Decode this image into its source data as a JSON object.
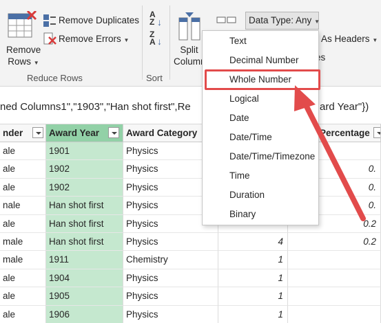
{
  "ribbon": {
    "remove_duplicates": "Remove Duplicates",
    "remove_errors": "Remove Errors",
    "remove_rows_line1": "Remove",
    "remove_rows_line2": "Rows",
    "reduce_rows_group": "Reduce Rows",
    "sort_group": "Sort",
    "split_line1": "Split",
    "split_line2": "Column",
    "data_type_button": "Data Type: Any",
    "as_headers": "As Headers",
    "partial_es": "es"
  },
  "formula_bar": {
    "text_left": "ned Columns1\",\"1903\",\"Han shot first\",Re",
    "text_right": "ard Year\"})"
  },
  "data_type_menu": {
    "items": [
      "Text",
      "Decimal Number",
      "Whole Number",
      "Logical",
      "Date",
      "Date/Time",
      "Date/Time/Timezone",
      "Time",
      "Duration",
      "Binary"
    ],
    "highlighted": "Whole Number",
    "annotation_color": "#e24b4b"
  },
  "table": {
    "headers": {
      "gender": "nder",
      "award_year": "Award Year",
      "award_category": "Award Category",
      "percentage": "Percentage"
    },
    "rows": [
      {
        "gender": "ale",
        "award_year": "1901",
        "category": "Physics",
        "value": "",
        "pct": ""
      },
      {
        "gender": "ale",
        "award_year": "1902",
        "category": "Physics",
        "value": "",
        "pct": "0."
      },
      {
        "gender": "ale",
        "award_year": "1902",
        "category": "Physics",
        "value": "",
        "pct": "0."
      },
      {
        "gender": "nale",
        "award_year": "Han shot first",
        "category": "Physics",
        "value": "",
        "pct": "0."
      },
      {
        "gender": "ale",
        "award_year": "Han shot first",
        "category": "Physics",
        "value": "",
        "pct": "0.2"
      },
      {
        "gender": "male",
        "award_year": "Han shot first",
        "category": "Physics",
        "value": "4",
        "pct": "0.2"
      },
      {
        "gender": "male",
        "award_year": "1911",
        "category": "Chemistry",
        "value": "1",
        "pct": ""
      },
      {
        "gender": "ale",
        "award_year": "1904",
        "category": "Physics",
        "value": "1",
        "pct": ""
      },
      {
        "gender": "ale",
        "award_year": "1905",
        "category": "Physics",
        "value": "1",
        "pct": ""
      },
      {
        "gender": "ale",
        "award_year": "1906",
        "category": "Physics",
        "value": "1",
        "pct": ""
      }
    ]
  },
  "colors": {
    "selected_header": "#92d1a7",
    "selected_cells": "#c5e8cf",
    "annotation": "#e24b4b"
  }
}
